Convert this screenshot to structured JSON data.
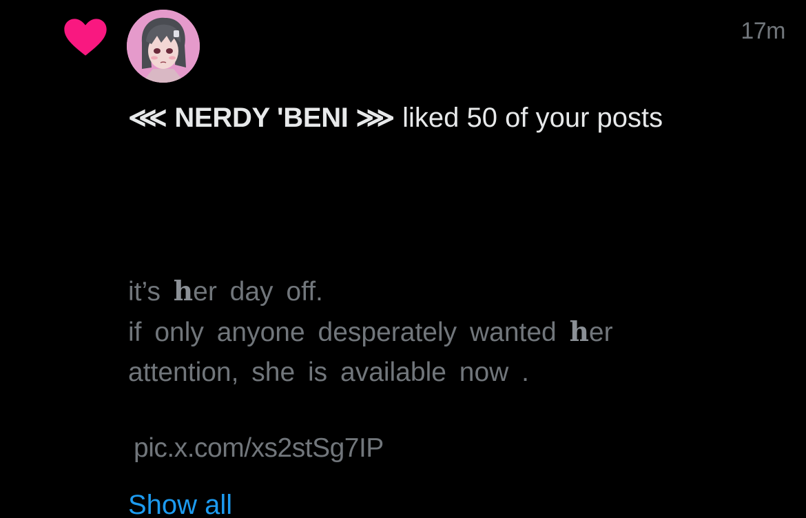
{
  "notification": {
    "type_icon": "heart-icon",
    "accent_color": "#f91880",
    "timestamp": "17m",
    "avatar": "avatar-image",
    "user_name": "⋘ NERDY 'BENI ⋙",
    "action_text": " liked 50 of your posts",
    "post_preview": {
      "line1_a": "it’s ",
      "line1_b": "h",
      "line1_c": "er day off.",
      "line2_a": "if only anyone desperately wanted ",
      "line2_b": "h",
      "line2_c": "er",
      "line3": "attention, she is available now ."
    },
    "post_link": "pic.x.com/xs2stSg7IP",
    "show_all_label": "Show all",
    "link_color": "#1d9bf0"
  }
}
